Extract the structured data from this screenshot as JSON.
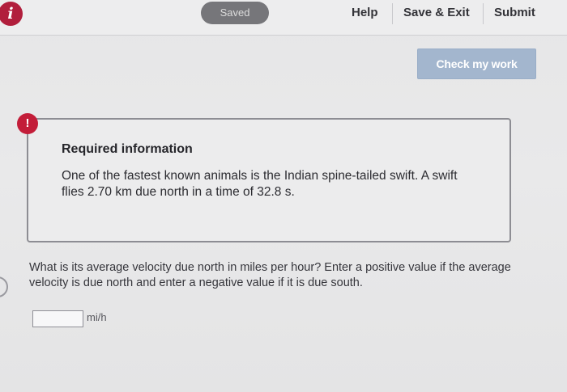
{
  "header": {
    "info_icon": "info-icon",
    "info_glyph": "i",
    "saved_label": "Saved",
    "help_label": "Help",
    "save_exit_label": "Save & Exit",
    "submit_label": "Submit"
  },
  "check_button_label": "Check my work",
  "required_info": {
    "badge_glyph": "!",
    "title": "Required information",
    "text": "One of the fastest known animals is the Indian spine-tailed swift. A swift flies 2.70 km due north in a time of 32.8 s."
  },
  "question": {
    "text": "What is its average velocity due north in miles per hour? Enter a positive value if the average velocity is due north and enter a negative value if it is due south.",
    "answer_value": "",
    "unit": "mi/h"
  },
  "colors": {
    "accent_red": "#c31d39",
    "check_button_bg": "#a3b6ce",
    "saved_pill_bg": "#76767a"
  }
}
